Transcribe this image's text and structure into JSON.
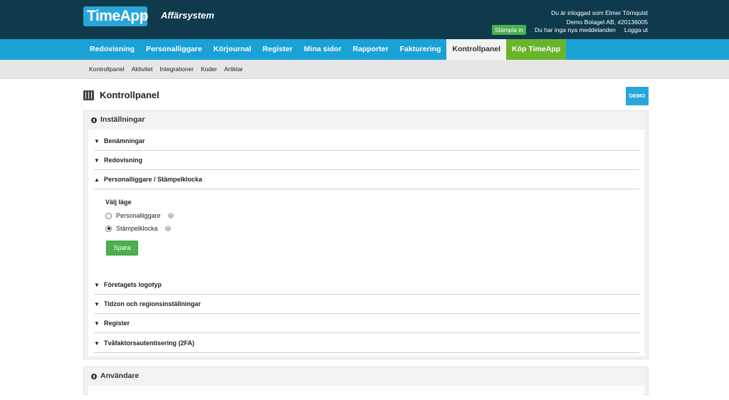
{
  "header": {
    "logo": "TimeApp",
    "logo_mark": "®",
    "subtitle": "Affärsystem",
    "user_line1": "Du är inloggad som Elmer Törnquist",
    "user_line2": "Demo Bolaget AB, #20136005",
    "stamp_button": "Stämpla in",
    "messages": "Du har inga nya meddelanden",
    "logout": "Logga ut"
  },
  "mainnav": {
    "items": [
      "Redovisning",
      "Personalliggare",
      "Körjournal",
      "Register",
      "Mina sidor",
      "Rapporter",
      "Fakturering",
      "Kontrollpanel",
      "Köp TimeApp"
    ],
    "active": "Kontrollpanel"
  },
  "subnav": {
    "items": [
      "Kontrollpanel",
      "Aktivitet",
      "Integrationer",
      "Koder",
      "Artiklar"
    ]
  },
  "page": {
    "title": "Kontrollpanel",
    "demo_badge": "DEMO"
  },
  "settings": {
    "heading": "Inställningar",
    "sections": [
      "Benämningar",
      "Redovisning",
      "Personalliggare / Stämpelklocka",
      "Företagets logotyp",
      "Tidzon och regionsinställningar",
      "Register",
      "Tvåfaktorsautentisering (2FA)"
    ],
    "expanded": "Personalliggare / Stämpelklocka",
    "mode_title": "Välj läge",
    "options": [
      "Personalliggare",
      "Stämpelklocka"
    ],
    "selected_option": "Stämpelklocka",
    "save_label": "Spara"
  },
  "users": {
    "heading": "Användare"
  },
  "colors": {
    "topbar": "#0e3a4c",
    "nav": "#1aa1d6",
    "buy": "#6ab42d",
    "save": "#4caf50"
  }
}
